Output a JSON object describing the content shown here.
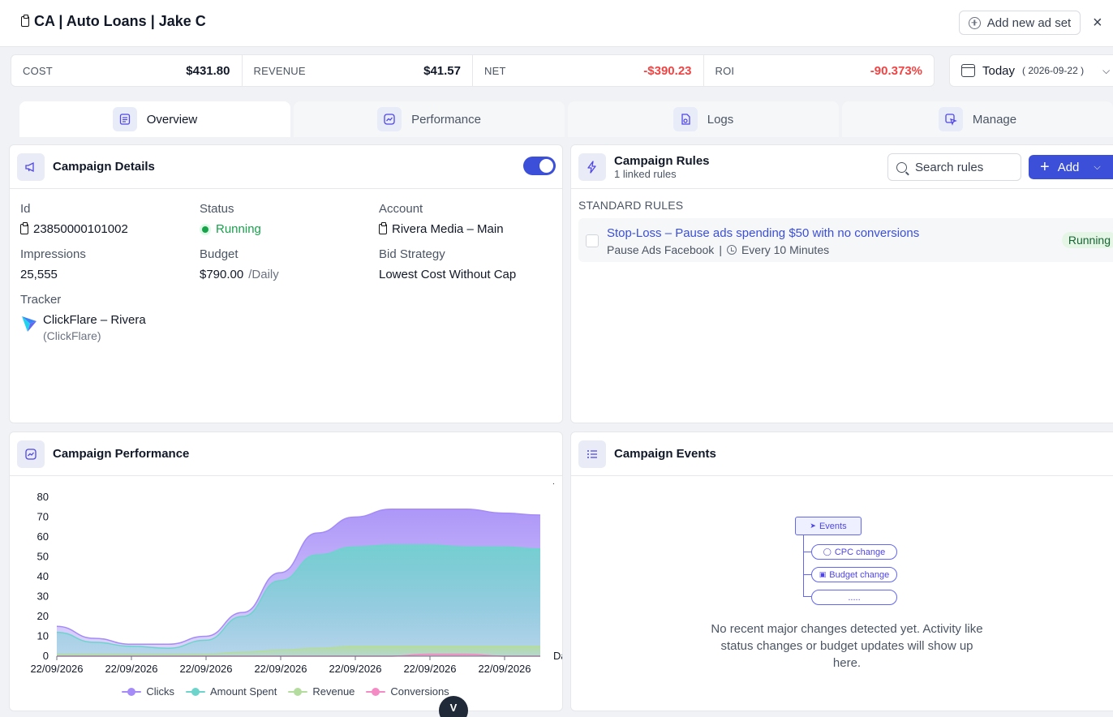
{
  "header": {
    "title": "CA | Auto Loans | Jake C",
    "add_adset_label": "Add new ad set",
    "close_label": "×"
  },
  "metrics": [
    {
      "label": "COST",
      "value": "$431.80"
    },
    {
      "label": "REVENUE",
      "value": "$41.57"
    },
    {
      "label": "NET",
      "value": "-$390.23"
    },
    {
      "label": "ROI",
      "value": "-90.373%"
    }
  ],
  "date_picker": {
    "label": "Today",
    "date": "( 2026-09-22 )"
  },
  "tabs": [
    {
      "label": "Overview",
      "active": true
    },
    {
      "label": "Performance"
    },
    {
      "label": "Logs"
    },
    {
      "label": "Manage"
    }
  ],
  "details": {
    "title": "Campaign Details",
    "id_label": "Id",
    "id_value": "23850000101002",
    "status_label": "Status",
    "status_value": "Running",
    "account_label": "Account",
    "account_value": "Rivera Media – Main",
    "impressions_label": "Impressions",
    "impressions_value": "25,555",
    "budget_label": "Budget",
    "budget_value": "$790.00",
    "budget_unit": "/Daily",
    "bid_label": "Bid Strategy",
    "bid_value": "Lowest Cost Without Cap",
    "tracker_label": "Tracker",
    "tracker_name": "ClickFlare – Rivera",
    "tracker_sub": "(ClickFlare)"
  },
  "rules": {
    "title": "Campaign Rules",
    "subtitle": "1 linked rules",
    "search_placeholder": "Search rules",
    "add_label": "Add",
    "section_label": "STANDARD RULES",
    "items": [
      {
        "title": "Stop-Loss – Pause ads spending $50 with no conversions",
        "action": "Pause Ads Facebook",
        "separator": "|",
        "schedule": "Every 10 Minutes",
        "status": "Running"
      }
    ]
  },
  "performance": {
    "title": "Campaign Performance",
    "side_label": "Da",
    "dot_label": "."
  },
  "events": {
    "title": "Campaign Events",
    "root_label": "Events",
    "children": [
      "CPC change",
      "Budget change",
      "....."
    ],
    "empty_text": "No recent major changes detected yet. Activity like status changes or budget updates will show up here."
  },
  "fab_label": "V",
  "colors": {
    "accent": "#3b4fd8",
    "negative": "#ef4444",
    "running": "#16a34a"
  },
  "chart_data": {
    "type": "area",
    "x": [
      "22/09/2026",
      "22/09/2026",
      "22/09/2026",
      "22/09/2026",
      "22/09/2026",
      "22/09/2026",
      "22/09/2026",
      "22/09/2026",
      "22/09/2026",
      "22/09/2026",
      "22/09/2026",
      "22/09/2026",
      "22/09/2026",
      "22/09/2026"
    ],
    "x_tick_labels": [
      "22/09/2026",
      "22/09/2026",
      "22/09/2026",
      "22/09/2026",
      "22/09/2026",
      "22/09/2026",
      "22/09/2026"
    ],
    "ylim": [
      0,
      80
    ],
    "y_ticks": [
      0,
      10,
      20,
      30,
      40,
      50,
      60,
      70,
      80
    ],
    "grid": false,
    "legend": "bottom",
    "series": [
      {
        "name": "Clicks",
        "color": "#a48bf7",
        "values": [
          15,
          9,
          6,
          6,
          10,
          22,
          42,
          62,
          70,
          74,
          74,
          74,
          72,
          71
        ]
      },
      {
        "name": "Amount Spent",
        "color": "#6dd4cc",
        "values": [
          12,
          7,
          5,
          4,
          8,
          20,
          38,
          51,
          55,
          56,
          56,
          55,
          55,
          54
        ]
      },
      {
        "name": "Revenue",
        "color": "#b5dc9f",
        "values": [
          1,
          1,
          1,
          1,
          1,
          2,
          3,
          4,
          5,
          5,
          5,
          5,
          5,
          5
        ]
      },
      {
        "name": "Conversions",
        "color": "#f48bc4",
        "values": [
          0,
          0,
          0,
          0,
          0,
          0,
          0,
          0,
          0,
          0,
          1,
          1,
          0,
          0
        ]
      }
    ]
  }
}
